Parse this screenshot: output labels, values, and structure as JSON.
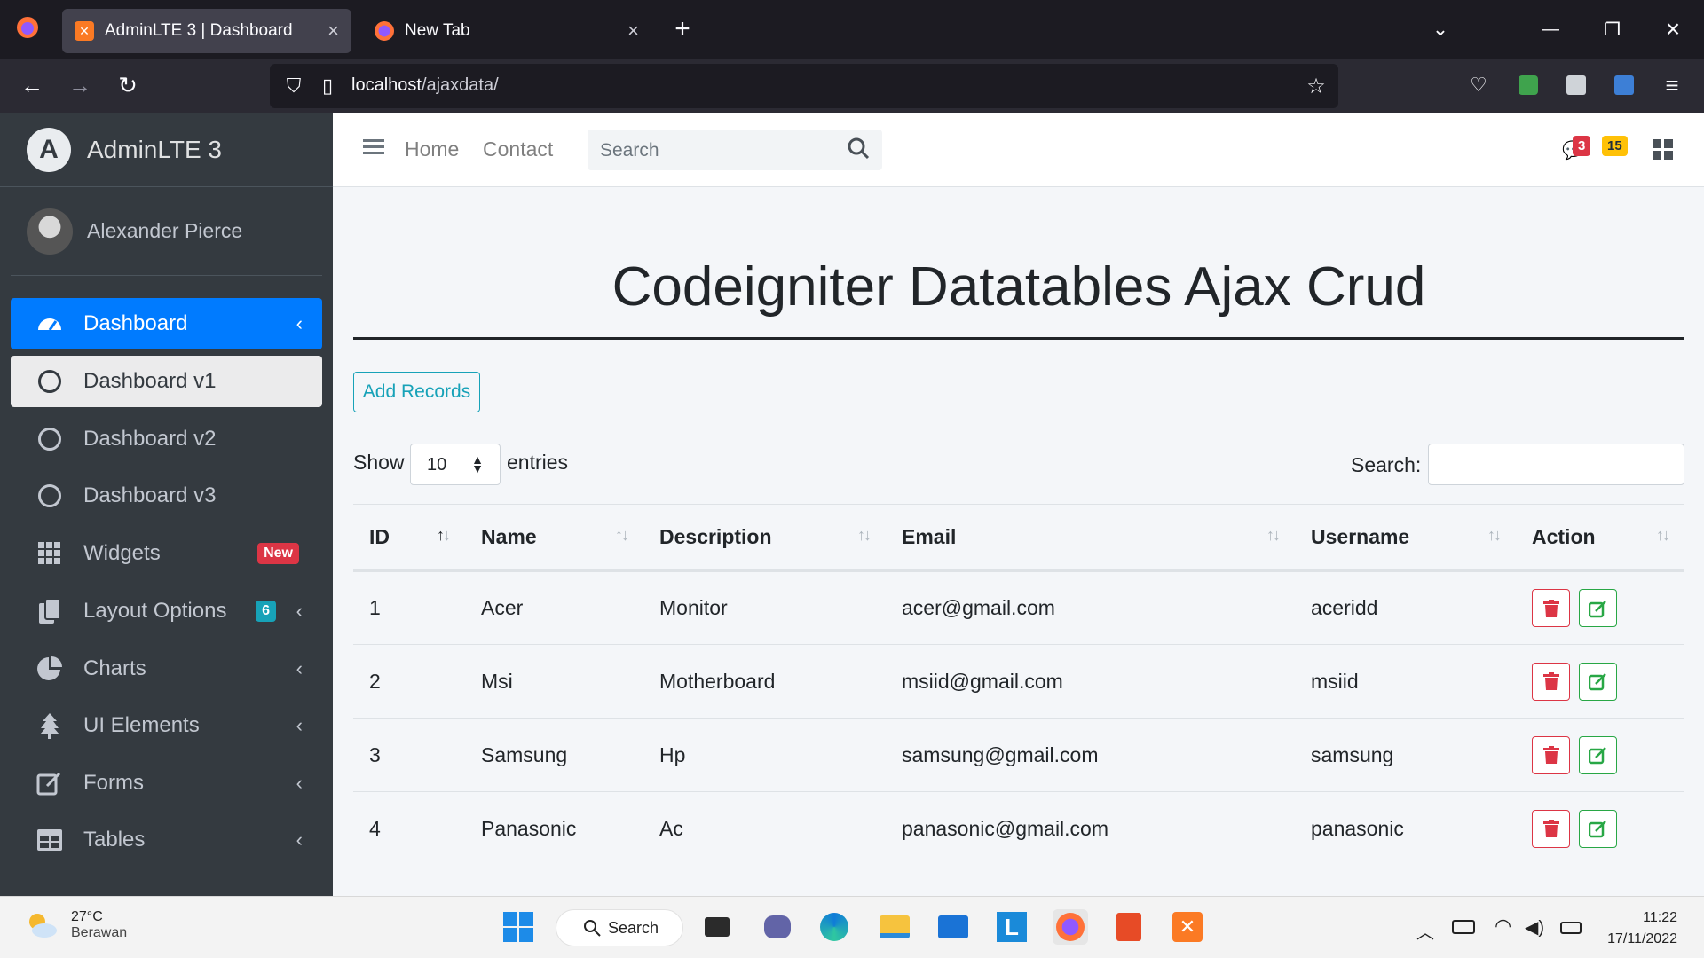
{
  "browser": {
    "tabs": [
      {
        "title": "AdminLTE 3 | Dashboard",
        "active": true
      },
      {
        "title": "New Tab",
        "active": false
      }
    ],
    "url_host": "localhost",
    "url_path": "/ajaxdata/"
  },
  "sidebar": {
    "brand": "AdminLTE 3",
    "brand_logo_letter": "A",
    "user_name": "Alexander Pierce",
    "items": [
      {
        "label": "Dashboard",
        "icon": "tachometer-icon"
      },
      {
        "label": "Dashboard v1",
        "icon": "circle-icon"
      },
      {
        "label": "Dashboard v2",
        "icon": "circle-icon"
      },
      {
        "label": "Dashboard v3",
        "icon": "circle-icon"
      },
      {
        "label": "Widgets",
        "icon": "grid-icon",
        "badge": "New",
        "badge_color": "#dc3545"
      },
      {
        "label": "Layout Options",
        "icon": "copy-icon",
        "badge": "6",
        "badge_color": "#17a2b8"
      },
      {
        "label": "Charts",
        "icon": "pie-chart-icon"
      },
      {
        "label": "UI Elements",
        "icon": "tree-icon"
      },
      {
        "label": "Forms",
        "icon": "edit-icon"
      },
      {
        "label": "Tables",
        "icon": "table-icon"
      }
    ]
  },
  "header": {
    "home": "Home",
    "contact": "Contact",
    "search_placeholder": "Search",
    "messages_count": "3",
    "notifications_count": "15"
  },
  "main": {
    "heading": "Codeigniter Datatables Ajax Crud",
    "add_button": "Add Records",
    "show_label": "Show",
    "entries_value": "10",
    "entries_label": "entries",
    "search_label": "Search:",
    "columns": [
      "ID",
      "Name",
      "Description",
      "Email",
      "Username",
      "Action"
    ],
    "rows": [
      {
        "id": "1",
        "name": "Acer",
        "description": "Monitor",
        "email": "acer@gmail.com",
        "username": "aceridd"
      },
      {
        "id": "2",
        "name": "Msi",
        "description": "Motherboard",
        "email": "msiid@gmail.com",
        "username": "msiid"
      },
      {
        "id": "3",
        "name": "Samsung",
        "description": "Hp",
        "email": "samsung@gmail.com",
        "username": "samsung"
      },
      {
        "id": "4",
        "name": "Panasonic",
        "description": "Ac",
        "email": "panasonic@gmail.com",
        "username": "panasonic"
      }
    ]
  },
  "taskbar": {
    "temp": "27°C",
    "weather": "Berawan",
    "search": "Search",
    "time": "11:22",
    "date": "17/11/2022"
  },
  "colors": {
    "primary": "#007bff",
    "sidebar_bg": "#343a40",
    "danger": "#dc3545",
    "success": "#28a745",
    "info": "#17a2b8",
    "warning": "#ffc107"
  }
}
